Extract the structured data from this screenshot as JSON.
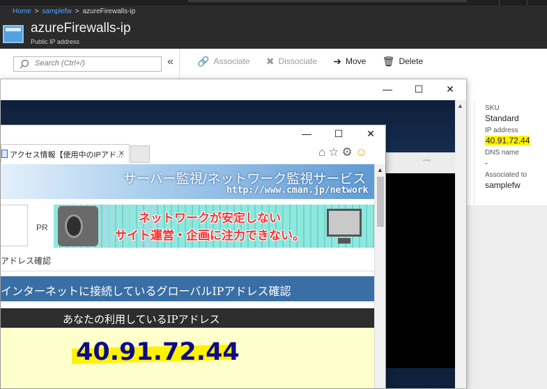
{
  "portal": {
    "breadcrumb": [
      "Home",
      "samplefw",
      "azureFirewalls-ip"
    ],
    "breadcrumb_sep": ">",
    "resource_title": "azureFirewalls-ip",
    "resource_type": "Public IP address",
    "search_placeholder": "Search (Ctrl+/)",
    "collapse_label": "«",
    "toolbar": [
      {
        "label": "Associate",
        "icon": "link-icon",
        "glyph": "🔗",
        "enabled": false
      },
      {
        "label": "Dissociate",
        "icon": "x-icon",
        "glyph": "✖",
        "enabled": false
      },
      {
        "label": "Move",
        "icon": "arrow-right-icon",
        "glyph": "➔",
        "enabled": true
      },
      {
        "label": "Delete",
        "icon": "trash-icon",
        "glyph": "🗑",
        "enabled": true
      }
    ],
    "properties": [
      {
        "label": "SKU",
        "value": "Standard",
        "highlight": false
      },
      {
        "label": "IP address",
        "value": "40.91.72.44",
        "highlight": true
      },
      {
        "label": "DNS name",
        "value": "-",
        "highlight": false
      },
      {
        "label": "Associated to",
        "value": "samplefw",
        "highlight": false
      }
    ]
  },
  "back_window": {
    "controls": {
      "minimize": "—",
      "maximize": "☐",
      "close": "✕"
    },
    "ghost_min": "—"
  },
  "browser": {
    "controls": {
      "minimize": "—",
      "maximize": "☐",
      "close": "✕"
    },
    "tab_label": "アクセス情報【使用中のIPアド...",
    "tab_close": "✕",
    "icons": {
      "home": "⌂",
      "star": "☆",
      "gear": "⚙",
      "smile": "☺"
    },
    "scroll_up": "▲"
  },
  "page": {
    "banner_title": "サーバー監視/ネットワーク監視サービス",
    "banner_url": "http://www.cman.jp/network",
    "pr_label": "PR",
    "ad_line1": "ネットワークが安定しない",
    "ad_line2": "サイト運営・企画に注力できない。",
    "crumb": "アドレス確認",
    "heading": "インターネットに接続しているグローバルIPアドレス確認",
    "your_ip_label": "あなたの利用しているIPアドレス",
    "ip_value": "40.91.72.44"
  },
  "colors": {
    "highlight": "#fff200",
    "heading_bar": "#3a6fa5",
    "ip_text": "#0c0c8a",
    "link": "#55a6ff"
  }
}
